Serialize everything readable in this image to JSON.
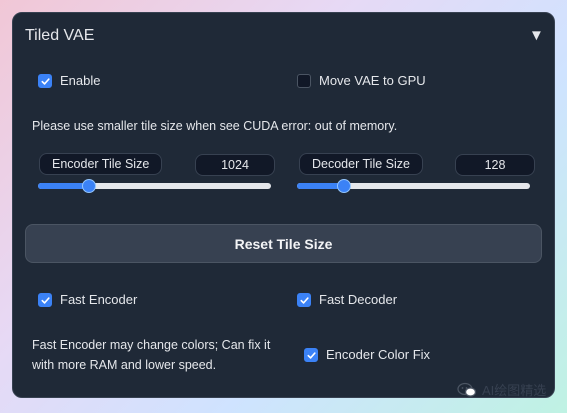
{
  "panel": {
    "title": "Tiled VAE",
    "collapse_icon": "triangle-down-icon"
  },
  "options": {
    "enable": {
      "label": "Enable",
      "checked": true
    },
    "move_vae": {
      "label": "Move VAE to GPU",
      "checked": false
    }
  },
  "warning_text": "Please use smaller tile size when see CUDA error: out of memory.",
  "encoder_tile": {
    "label": "Encoder Tile Size",
    "value": "1024",
    "fraction": 0.22
  },
  "decoder_tile": {
    "label": "Decoder Tile Size",
    "value": "128",
    "fraction": 0.2
  },
  "reset_button": "Reset Tile Size",
  "fast_encoder": {
    "label": "Fast Encoder",
    "checked": true
  },
  "fast_decoder": {
    "label": "Fast Decoder",
    "checked": true
  },
  "fast_encoder_note_line1": "Fast Encoder may change colors; Can fix it",
  "fast_encoder_note_line2": "with more RAM and lower speed.",
  "encoder_color_fix": {
    "label": "Encoder Color Fix",
    "checked": true
  },
  "watermark": "AI绘图精选",
  "colors": {
    "accent": "#3b82f6",
    "panel_bg": "#1f2937"
  }
}
